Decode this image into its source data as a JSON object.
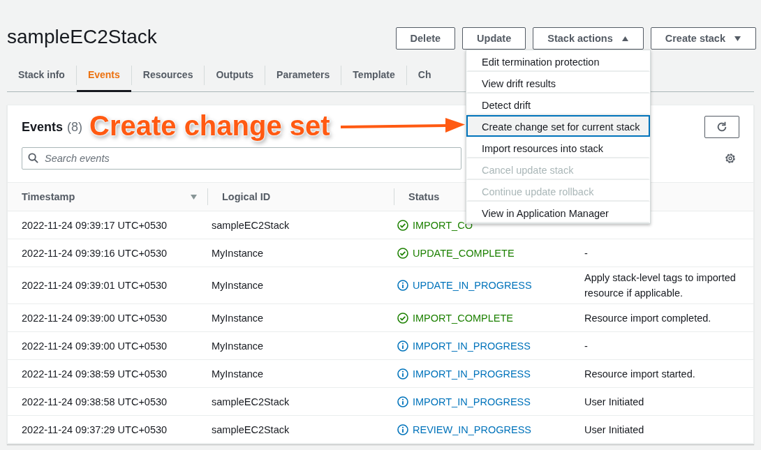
{
  "title": "sampleEC2Stack",
  "buttons": [
    {
      "label": "Delete",
      "kind": "plain"
    },
    {
      "label": "Update",
      "kind": "plain"
    },
    {
      "label": "Stack actions",
      "kind": "caret-up"
    },
    {
      "label": "Create stack",
      "kind": "caret-down"
    }
  ],
  "tabs": [
    {
      "label": "Stack info",
      "selected": false
    },
    {
      "label": "Events",
      "selected": true
    },
    {
      "label": "Resources",
      "selected": false
    },
    {
      "label": "Outputs",
      "selected": false
    },
    {
      "label": "Parameters",
      "selected": false
    },
    {
      "label": "Template",
      "selected": false
    },
    {
      "label": "Ch",
      "selected": false
    }
  ],
  "panel": {
    "title": "Events",
    "count": "(8)",
    "search": {
      "placeholder": "Search events"
    }
  },
  "table": {
    "columns": [
      "Timestamp",
      "Logical ID",
      "Status"
    ],
    "rows": [
      {
        "timestamp": "2022-11-24 09:39:17 UTC+0530",
        "logical_id": "sampleEC2Stack",
        "status": "IMPORT_CO",
        "kind": "complete",
        "reason": ""
      },
      {
        "timestamp": "2022-11-24 09:39:16 UTC+0530",
        "logical_id": "MyInstance",
        "status": "UPDATE_COMPLETE",
        "kind": "complete",
        "reason": "-"
      },
      {
        "timestamp": "2022-11-24 09:39:01 UTC+0530",
        "logical_id": "MyInstance",
        "status": "UPDATE_IN_PROGRESS",
        "kind": "progress",
        "reason": "Apply stack-level tags to imported resource if applicable."
      },
      {
        "timestamp": "2022-11-24 09:39:00 UTC+0530",
        "logical_id": "MyInstance",
        "status": "IMPORT_COMPLETE",
        "kind": "complete",
        "reason": "Resource import completed."
      },
      {
        "timestamp": "2022-11-24 09:39:00 UTC+0530",
        "logical_id": "MyInstance",
        "status": "IMPORT_IN_PROGRESS",
        "kind": "progress",
        "reason": "-"
      },
      {
        "timestamp": "2022-11-24 09:38:59 UTC+0530",
        "logical_id": "MyInstance",
        "status": "IMPORT_IN_PROGRESS",
        "kind": "progress",
        "reason": "Resource import started."
      },
      {
        "timestamp": "2022-11-24 09:38:58 UTC+0530",
        "logical_id": "sampleEC2Stack",
        "status": "IMPORT_IN_PROGRESS",
        "kind": "progress",
        "reason": "User Initiated"
      },
      {
        "timestamp": "2022-11-24 09:37:29 UTC+0530",
        "logical_id": "sampleEC2Stack",
        "status": "REVIEW_IN_PROGRESS",
        "kind": "progress",
        "reason": "User Initiated"
      }
    ]
  },
  "menu": [
    {
      "label": "Edit termination protection",
      "disabled": false,
      "selected": false
    },
    {
      "label": "View drift results",
      "disabled": false,
      "selected": false
    },
    {
      "label": "Detect drift",
      "disabled": false,
      "selected": false
    },
    {
      "label": "Create change set for current stack",
      "disabled": false,
      "selected": true
    },
    {
      "label": "Import resources into stack",
      "disabled": false,
      "selected": false
    },
    {
      "label": "Cancel update stack",
      "disabled": true,
      "selected": false
    },
    {
      "label": "Continue update rollback",
      "disabled": true,
      "selected": false
    },
    {
      "label": "View in Application Manager",
      "disabled": false,
      "selected": false
    }
  ],
  "annotation": {
    "text": "Create change set"
  }
}
